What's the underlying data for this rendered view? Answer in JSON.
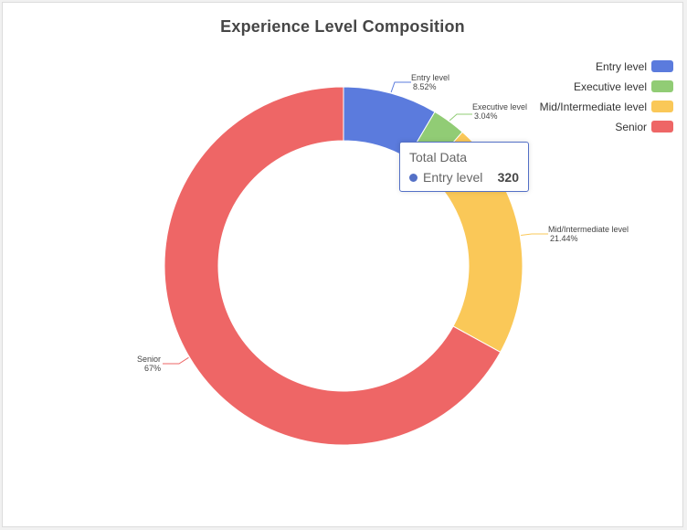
{
  "chart_data": {
    "type": "pie",
    "variant": "donut",
    "title": "Experience Level Composition",
    "legend_position": "top-right",
    "categories": [
      "Entry level",
      "Executive level",
      "Mid/Intermediate level",
      "Senior"
    ],
    "percent_labels": [
      "8.52%",
      "3.04%",
      "21.44%",
      "67%"
    ],
    "values": [
      8.52,
      3.04,
      21.44,
      67.0
    ],
    "colors": [
      "#5b7bdd",
      "#91cc75",
      "#fac858",
      "#ee6666"
    ]
  },
  "tooltip": {
    "title": "Total Data",
    "series_name": "Entry level",
    "value": "320",
    "color": "#5470c6"
  }
}
